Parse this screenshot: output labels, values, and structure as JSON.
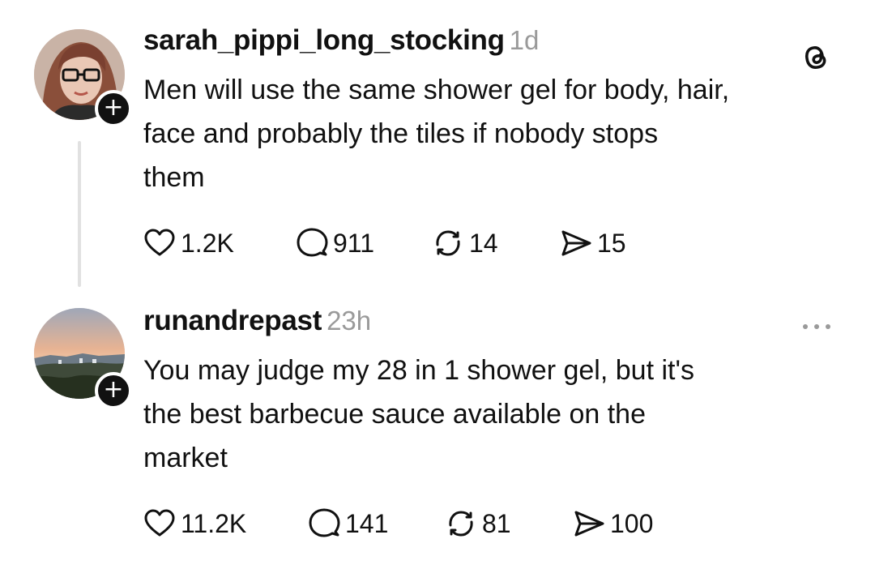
{
  "posts": [
    {
      "username": "sarah_pippi_long_stocking",
      "time": "1d",
      "text_lines": [
        "Men will use the same shower gel for body, hair,",
        "face and probably the tiles if nobody stops",
        "them"
      ],
      "likes": "1.2K",
      "replies": "911",
      "reposts": "14",
      "shares": "15",
      "header_icon": "threads-logo-icon"
    },
    {
      "username": "runandrepast",
      "time": "23h",
      "text_lines": [
        "You may judge my 28 in 1 shower gel, but it's",
        "the best barbecue sauce available on the",
        "market"
      ],
      "likes": "11.2K",
      "replies": "141",
      "reposts": "81",
      "shares": "100",
      "header_icon": "more-options-icon"
    }
  ],
  "follow_symbol": "+",
  "colors": {
    "text": "#111111",
    "muted": "#9a9a9a",
    "thread_line": "#e1e1e1",
    "badge": "#111111"
  }
}
